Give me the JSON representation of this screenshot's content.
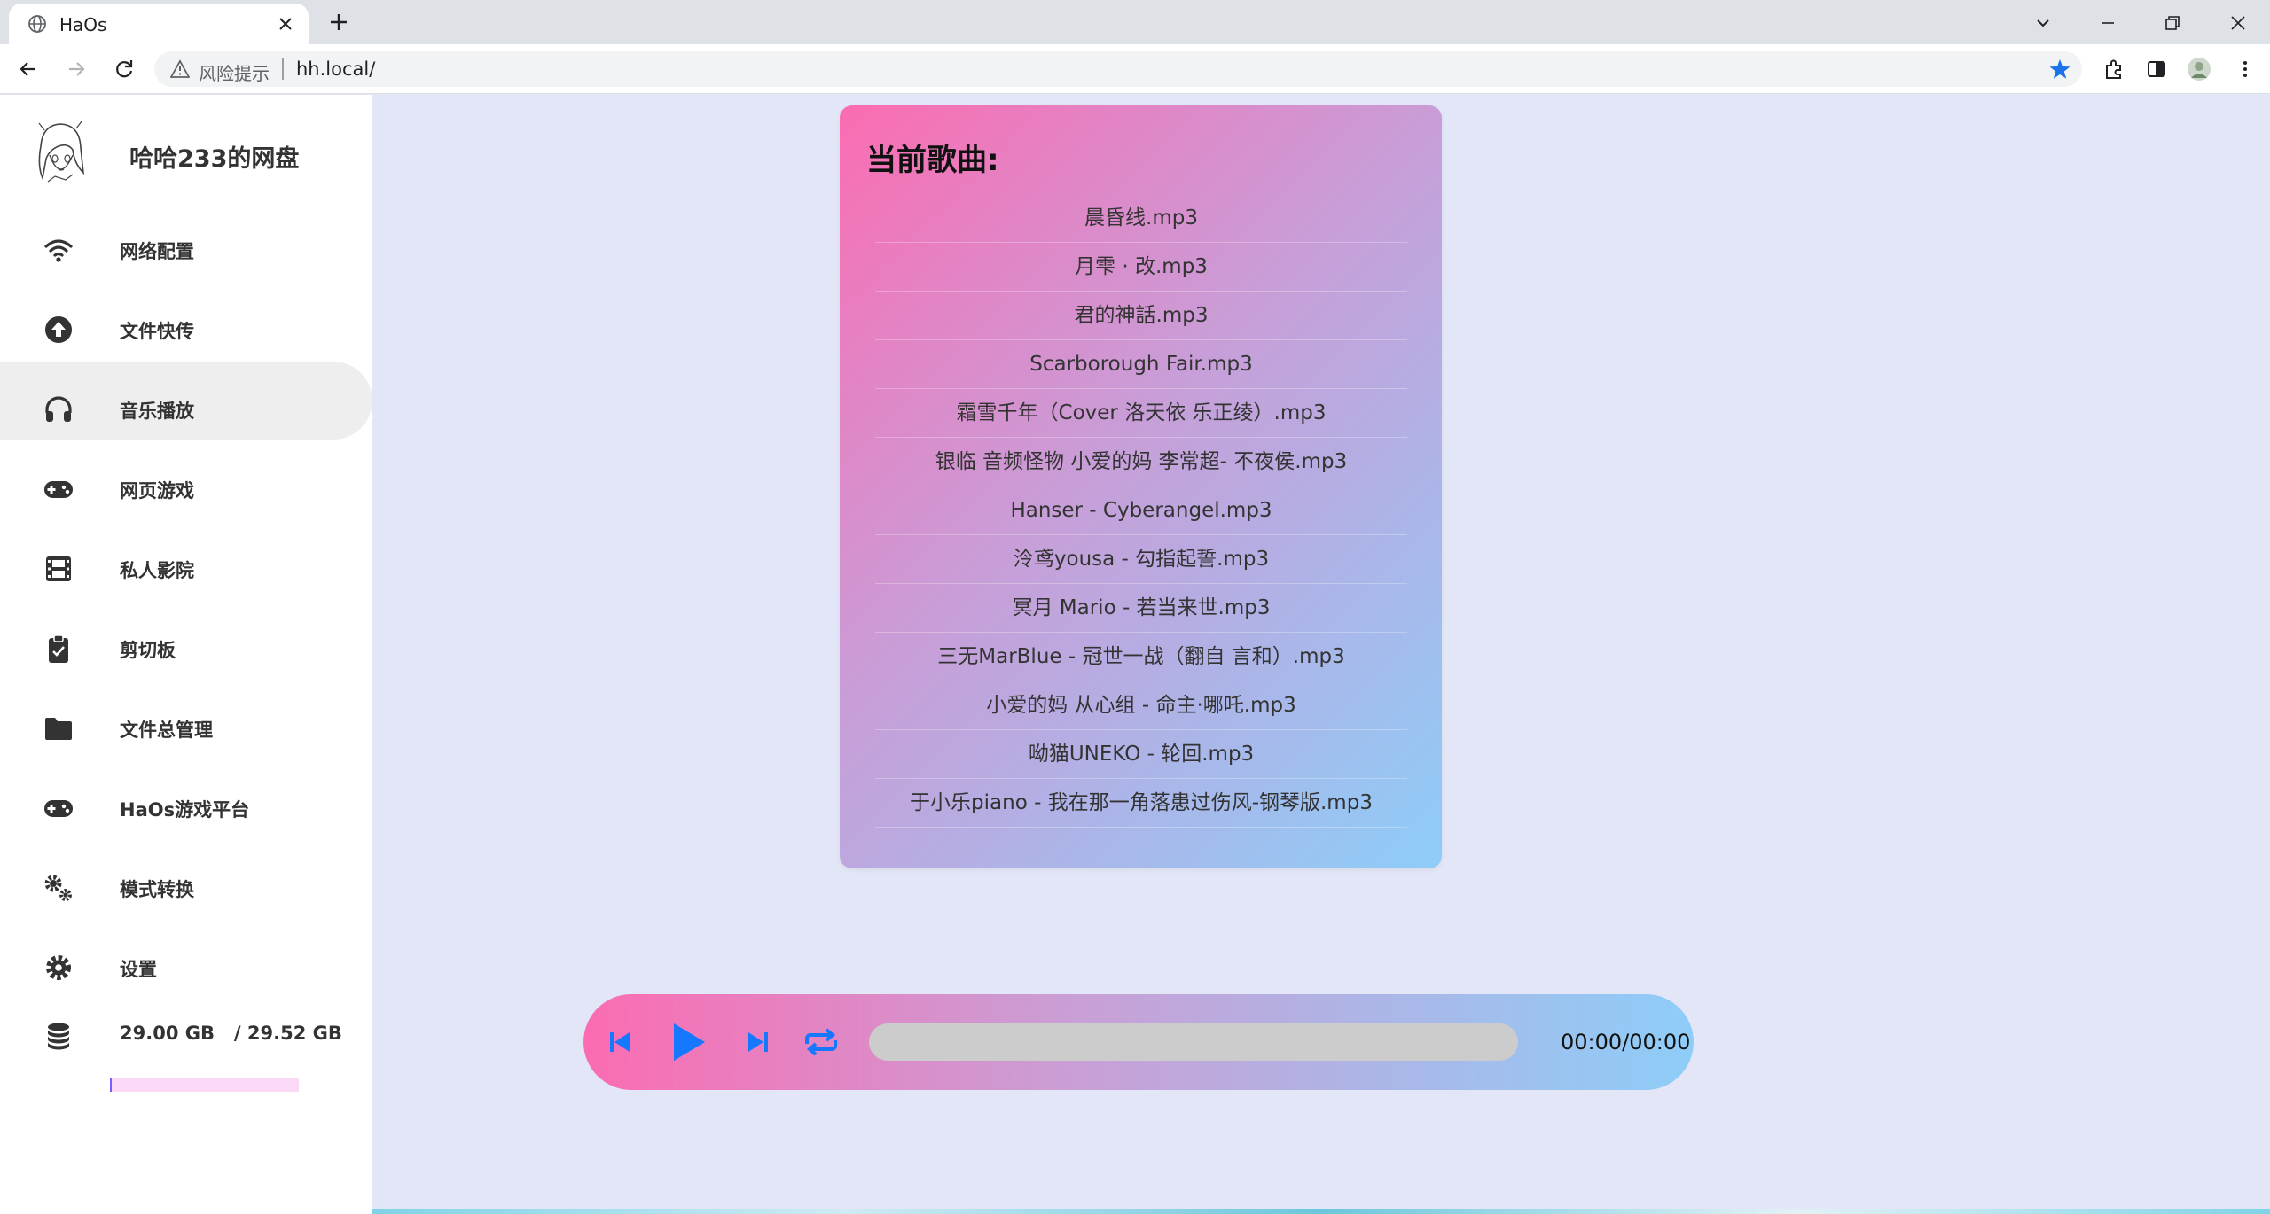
{
  "browser": {
    "tab_title": "HaOs",
    "risk_label": "风险提示",
    "url": "hh.local/"
  },
  "sidebar": {
    "brand_title": "哈哈233的网盘",
    "items": [
      {
        "label": "网络配置",
        "icon": "wifi-icon"
      },
      {
        "label": "文件快传",
        "icon": "upload-icon"
      },
      {
        "label": "音乐播放",
        "icon": "headphones-icon",
        "active": true
      },
      {
        "label": "网页游戏",
        "icon": "gamepad-icon"
      },
      {
        "label": "私人影院",
        "icon": "film-icon"
      },
      {
        "label": "剪切板",
        "icon": "clipboard-icon"
      },
      {
        "label": "文件总管理",
        "icon": "folder-icon"
      },
      {
        "label": "HaOs游戏平台",
        "icon": "gamepad-icon"
      },
      {
        "label": "模式转换",
        "icon": "gears-icon"
      },
      {
        "label": "设置",
        "icon": "gear-icon"
      }
    ],
    "storage": {
      "text": "29.00 GB   / 29.52 GB",
      "used_fraction": 0.01
    }
  },
  "playlist": {
    "title": "当前歌曲:",
    "songs": [
      "晨昏线.mp3",
      "月雫 · 改.mp3",
      "君的神話.mp3",
      "Scarborough Fair.mp3",
      "霜雪千年（Cover 洛天依 乐正绫）.mp3",
      "银临 音频怪物 小爱的妈 李常超- 不夜侯.mp3",
      "Hanser - Cyberangel.mp3",
      "泠鸢yousa - 勾指起誓.mp3",
      "冥月 Mario - 若当来世.mp3",
      "三无MarBlue - 冠世一战（翻自 言和）.mp3",
      "小爱的妈 从心组 - 命主·哪吒.mp3",
      "呦猫UNEKO - 轮回.mp3",
      "于小乐piano - 我在那一角落患过伤风-钢琴版.mp3"
    ]
  },
  "player": {
    "time": "00:00/00:00",
    "progress_fraction": 0
  },
  "colors": {
    "accent_blue": "#1677ff",
    "gradient_pink": "#fb6cb2",
    "gradient_blue": "#8ecdf8",
    "page_bg": "#e2e6f6"
  }
}
